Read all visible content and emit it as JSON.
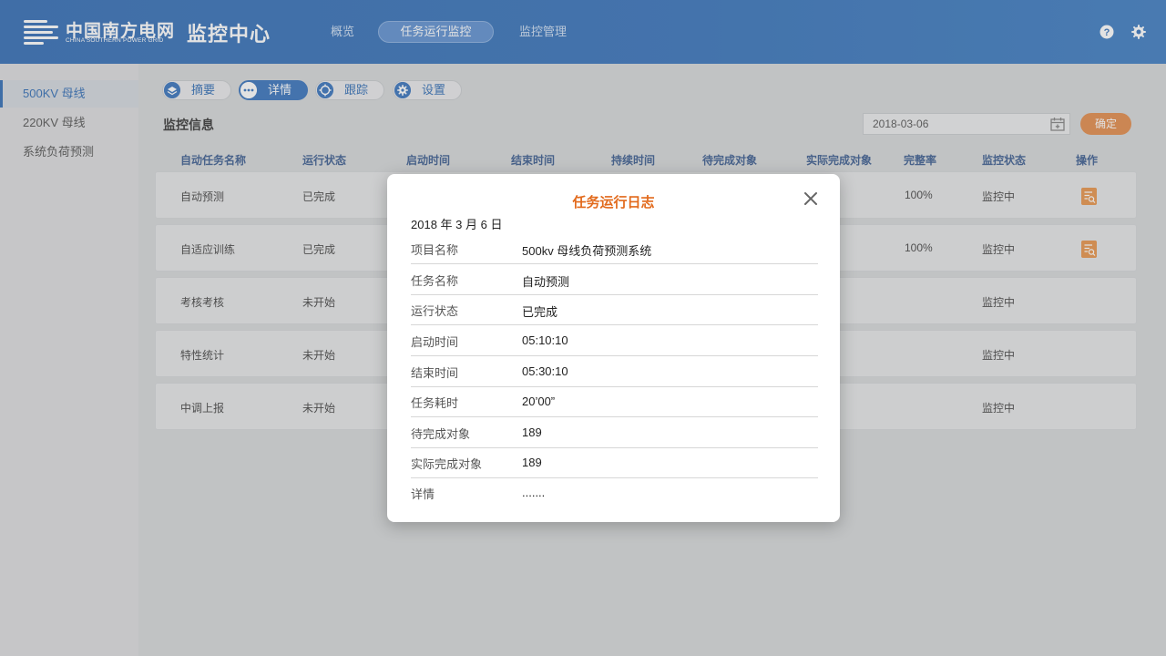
{
  "header": {
    "logo_cn": "中国南方电网",
    "logo_en": "CHINA SOUTHERN POWER GRID",
    "app_title": "监控中心",
    "nav": [
      "概览",
      "任务运行监控",
      "监控管理"
    ],
    "nav_active": "任务运行监控",
    "icons": [
      "help-icon",
      "gear-icon"
    ]
  },
  "sidebar": {
    "items": [
      "500KV 母线",
      "220KV 母线",
      "系统负荷预测"
    ],
    "active": "500KV 母线"
  },
  "toolbar": {
    "tabs": [
      "摘要",
      "详情",
      "跟踪",
      "设置"
    ],
    "active": "详情"
  },
  "section": {
    "title": "监控信息",
    "date": "2018-03-06",
    "confirm": "确定"
  },
  "table": {
    "headers": [
      "自动任务名称",
      "运行状态",
      "启动时间",
      "结束时间",
      "持续时间",
      "待完成对象",
      "实际完成对象",
      "完整率",
      "监控状态",
      "操作"
    ],
    "rows": [
      {
        "name": "自动预测",
        "status": "已完成",
        "rate": "100%",
        "monitor": "监控中"
      },
      {
        "name": "自适应训练",
        "status": "已完成",
        "rate": "100%",
        "monitor": "监控中"
      },
      {
        "name": "考核考核",
        "status": "未开始",
        "rate": "",
        "monitor": "监控中"
      },
      {
        "name": "特性统计",
        "status": "未开始",
        "rate": "",
        "monitor": "监控中"
      },
      {
        "name": "中调上报",
        "status": "未开始",
        "rate": "",
        "monitor": "监控中"
      }
    ]
  },
  "modal": {
    "title": "任务运行日志",
    "date": "2018 年 3 月 6 日",
    "fields": [
      {
        "key": "项目名称",
        "value": "500kv 母线负荷预测系统"
      },
      {
        "key": "任务名称",
        "value": "自动预测"
      },
      {
        "key": "运行状态",
        "value": "已完成"
      },
      {
        "key": "启动时间",
        "value": "05:10:10"
      },
      {
        "key": "结束时间",
        "value": "05:30:10"
      },
      {
        "key": "任务耗时",
        "value": "20’00”"
      },
      {
        "key": "待完成对象",
        "value": "189"
      },
      {
        "key": "实际完成对象",
        "value": "189"
      },
      {
        "key": "详情",
        "value": "......."
      }
    ]
  },
  "colors": {
    "header": "#2466b4",
    "accent_orange": "#e0803a",
    "modal_title": "#e26a1c",
    "primary_blue": "#2566b6"
  }
}
